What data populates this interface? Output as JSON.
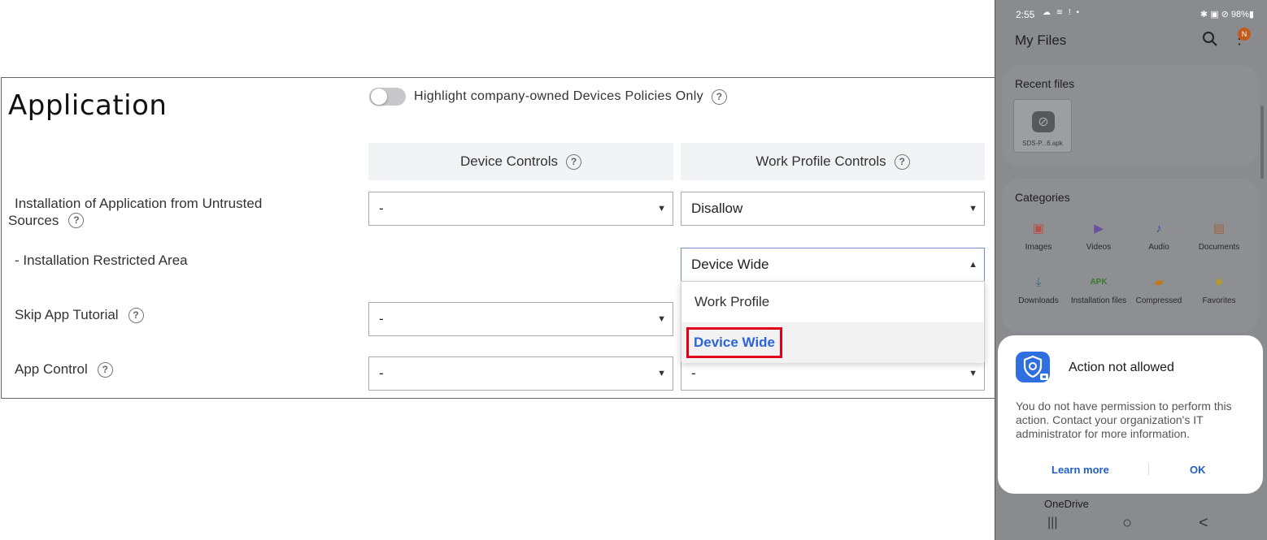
{
  "policy": {
    "title": "Application",
    "highlight_toggle_label": "Highlight company-owned Devices Policies Only",
    "columns": [
      "Device Controls",
      "Work Profile Controls"
    ],
    "rows": [
      {
        "label_line1": "Installation of Application from Untrusted",
        "label_line2": "Sources",
        "device": "-",
        "work": "Disallow"
      },
      {
        "label": "- Installation Restricted Area",
        "work": "Device Wide"
      },
      {
        "label": "Skip App Tutorial",
        "device": "-"
      },
      {
        "label": "App Control",
        "device": "-",
        "work": "-"
      }
    ],
    "dropdown_options": [
      "Work Profile",
      "Device Wide"
    ],
    "help_glyph": "?",
    "caret_down": "▼",
    "caret_up": "▲"
  },
  "phone": {
    "status_time": "2:55",
    "status_icons": "☁ ≋ ! •",
    "status_right": "✱ ▣ ⊘ 98%▮",
    "app_title": "My Files",
    "badge": "N",
    "recent_title": "Recent files",
    "recent_file_name": "SDS-P...6.apk",
    "categories_title": "Categories",
    "categories": [
      "Images",
      "Videos",
      "Audio",
      "Documents",
      "Downloads",
      "Installation files",
      "Compressed",
      "Favorites"
    ],
    "apk_icon_text": "APK",
    "dialog": {
      "title": "Action not allowed",
      "body": "You do not have permission to perform this action. Contact your organization's IT administrator for more information.",
      "learn_more": "Learn more",
      "ok": "OK"
    },
    "behind_dialog_text": "OneDrive",
    "nav": {
      "recents": "|||",
      "home": "○",
      "back": "<"
    },
    "colors": {
      "dialog_button": "#1f5fbf",
      "badge": "#c45a1c",
      "selected_option": "#2c64d8",
      "highlight_border": "#e1001a"
    }
  }
}
